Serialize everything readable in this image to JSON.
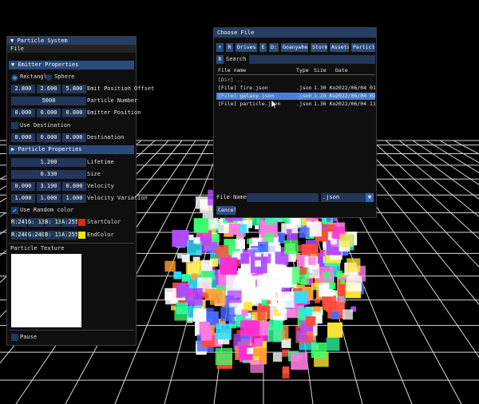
{
  "particle_panel": {
    "title": "Particle System",
    "menu": "File",
    "emitter_header": "Emitter Properties",
    "shape_options": [
      "Rectangle",
      "Sphere"
    ],
    "emit_offset": {
      "values": [
        "2.800",
        "2.600",
        "5.800"
      ],
      "label": "Emit Position Offset"
    },
    "particle_number": {
      "value": "5000",
      "label": "Particle Number"
    },
    "emitter_position": {
      "values": [
        "0.000",
        "0.000",
        "0.000"
      ],
      "label": "Emitter Position"
    },
    "use_destination": "Use Destination",
    "destination": {
      "values": [
        "0.000",
        "0.000",
        "0.000"
      ],
      "label": "Destination"
    },
    "particle_header": "Particle Properties",
    "lifetime": {
      "value": "1.200",
      "label": "Lifetime"
    },
    "size": {
      "value": "0.330",
      "label": "Size"
    },
    "velocity": {
      "values": [
        "0.000",
        "3.190",
        "0.000"
      ],
      "label": "Velocity"
    },
    "velocity_variation": {
      "values": [
        "1.000",
        "1.000",
        "1.000"
      ],
      "label": "Velocity Variation"
    },
    "use_random_color": "Use Random color",
    "start_color": {
      "values": [
        "R:241",
        "G: 13",
        "B: 13",
        "A:255"
      ],
      "label": "StartColor",
      "swatch": "#e3260f"
    },
    "end_color": {
      "values": [
        "R:240",
        "G:240",
        "B: 11",
        "A:255"
      ],
      "label": "EndColor",
      "swatch": "#f2e40c"
    },
    "texture_label": "Particle Texture",
    "pause_label": "Pause"
  },
  "file_dialog": {
    "title": "Choose File",
    "path_buttons": [
      "+",
      "R",
      "Drives",
      "E",
      "D:",
      "Goanywhere",
      "Storm",
      "Assets",
      "ParticlePro"
    ],
    "search_button": "R",
    "search_label": "Search :",
    "columns": [
      "File name",
      "Type",
      "Size",
      "Date"
    ],
    "rows": [
      {
        "name": "[Dir] ..",
        "type": "",
        "size": "",
        "date": ""
      },
      {
        "name": "[File] fire.json",
        "type": ".json",
        "size": "1.30 Ko",
        "date": "2022/06/04 01:58"
      },
      {
        "name": "[File] galaxy.json",
        "type": ".json",
        "size": "1.29 Ko",
        "date": "2022/06/04 02:00"
      },
      {
        "name": "[File] particle.json",
        "type": ".json",
        "size": "1.36 Ko",
        "date": "2022/06/04 11:17"
      }
    ],
    "filename_label": "File Name :",
    "filename_value": "",
    "filter_value": ".json",
    "cancel_label": "Cancel"
  },
  "colors": {
    "accent": "#2a4a7c",
    "selected_row": "#4a7fd6",
    "start_color": "#e3260f",
    "end_color": "#f2e40c"
  }
}
